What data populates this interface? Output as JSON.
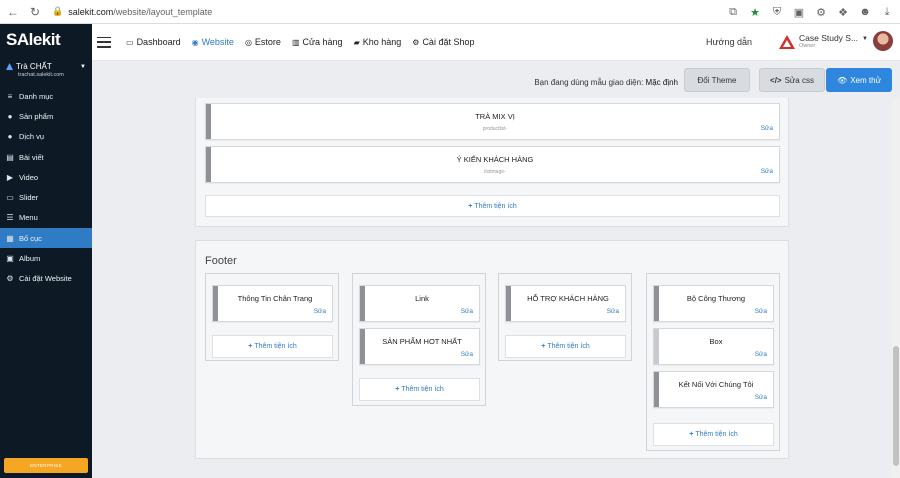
{
  "browser": {
    "url_host": "salekit.com",
    "url_path": "/website/layout_template"
  },
  "sidebar": {
    "logo": "SAlekit",
    "shop_name": "Trà CHẤT",
    "shop_domain": "trachat.salekit.com",
    "items": [
      {
        "label": "Danh mục",
        "icon": "list-icon"
      },
      {
        "label": "Sản phẩm",
        "icon": "product-icon"
      },
      {
        "label": "Dịch vụ",
        "icon": "service-icon"
      },
      {
        "label": "Bài viết",
        "icon": "article-icon"
      },
      {
        "label": "Video",
        "icon": "video-icon"
      },
      {
        "label": "Slider",
        "icon": "slider-icon"
      },
      {
        "label": "Menu",
        "icon": "menu-icon"
      },
      {
        "label": "Bố cục",
        "icon": "layout-icon",
        "active": true
      },
      {
        "label": "Album",
        "icon": "album-icon"
      },
      {
        "label": "Cài đặt Website",
        "icon": "settings-icon"
      }
    ],
    "upgrade_label": "ENTERPRISE"
  },
  "header": {
    "nav": [
      {
        "label": "Dashboard",
        "icon": "monitor-icon"
      },
      {
        "label": "Website",
        "icon": "globe-icon",
        "active": true
      },
      {
        "label": "Estore",
        "icon": "compass-icon"
      },
      {
        "label": "Cửa hàng",
        "icon": "store-icon"
      },
      {
        "label": "Kho hàng",
        "icon": "warehouse-icon"
      },
      {
        "label": "Cài đặt Shop",
        "icon": "gear-icon"
      }
    ],
    "guide": "Hướng dẫn",
    "user_name": "Case Study S...",
    "user_role": "Owner"
  },
  "toolbar": {
    "theme_prefix": "Bạn đang dùng mẫu giao diện:",
    "theme_name": "Mặc định",
    "change_theme": "Đổi Theme",
    "edit_css": "Sửa css",
    "preview": "Xem thử"
  },
  "main_section": {
    "widgets": [
      {
        "title": "TRÀ MIX VỊ",
        "sub": "productlist-",
        "edit": "Sửa"
      },
      {
        "title": "Ý KIẾN KHÁCH HÀNG",
        "sub": "listimage-",
        "edit": "Sửa"
      }
    ],
    "add_label": "Thêm tiện ích"
  },
  "footer": {
    "title": "Footer",
    "columns": [
      {
        "widgets": [
          {
            "title": "Thông Tin Chân Trang",
            "edit": "Sửa"
          }
        ],
        "add_label": "Thêm tiện ích"
      },
      {
        "widgets": [
          {
            "title": "Link",
            "edit": "Sửa"
          },
          {
            "title": "SẢN PHẨM HOT NHẤT",
            "edit": "Sửa"
          }
        ],
        "add_label": "Thêm tiện ích"
      },
      {
        "widgets": [
          {
            "title": "HỖ TRỢ KHÁCH HÀNG",
            "edit": "Sửa"
          }
        ],
        "add_label": "Thêm tiện ích"
      },
      {
        "widgets": [
          {
            "title": "Bộ Công Thương",
            "edit": "Sửa"
          },
          {
            "title": "Box",
            "edit": "Sửa"
          },
          {
            "title": "Kết Nối Với Chúng Tôi",
            "edit": "Sửa"
          }
        ],
        "add_label": "Thêm tiện ích"
      }
    ]
  }
}
